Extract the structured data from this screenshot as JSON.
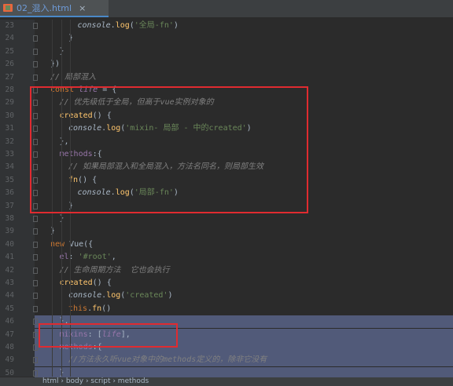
{
  "tab": {
    "title": "02_混入.html",
    "close": "×"
  },
  "lines": [
    {
      "n": "23",
      "indent": 3,
      "tokens": [
        [
          "ital plain",
          "console"
        ],
        [
          "plain",
          "."
        ],
        [
          "fn",
          "log"
        ],
        [
          "plain",
          "("
        ],
        [
          "str",
          "'全局-fn'"
        ],
        [
          "plain",
          ")"
        ]
      ]
    },
    {
      "n": "24",
      "indent": 2,
      "tokens": [
        [
          "plain",
          "}"
        ]
      ]
    },
    {
      "n": "25",
      "indent": 1,
      "tokens": [
        [
          "plain",
          "}"
        ]
      ]
    },
    {
      "n": "26",
      "indent": 0,
      "tokens": [
        [
          "plain",
          "})"
        ]
      ]
    },
    {
      "n": "27",
      "indent": 0,
      "tokens": [
        [
          "cmt",
          "// 局部混入"
        ]
      ]
    },
    {
      "n": "28",
      "indent": 0,
      "tokens": [
        [
          "kw",
          "const "
        ],
        [
          "prop ital",
          "life"
        ],
        [
          "plain",
          " = {"
        ]
      ]
    },
    {
      "n": "29",
      "indent": 1,
      "tokens": [
        [
          "cmt",
          "// 优先级低于全局，但高于vue实例对象的"
        ]
      ]
    },
    {
      "n": "30",
      "indent": 1,
      "tokens": [
        [
          "fn",
          "created"
        ],
        [
          "plain",
          "() {"
        ]
      ]
    },
    {
      "n": "31",
      "indent": 2,
      "tokens": [
        [
          "ital plain",
          "console"
        ],
        [
          "plain",
          "."
        ],
        [
          "fn",
          "log"
        ],
        [
          "plain",
          "("
        ],
        [
          "str",
          "'mixin- 局部 - 中的created'"
        ],
        [
          "plain",
          ")"
        ]
      ]
    },
    {
      "n": "32",
      "indent": 1,
      "tokens": [
        [
          "plain",
          "},"
        ]
      ]
    },
    {
      "n": "33",
      "indent": 1,
      "tokens": [
        [
          "prop",
          "methods"
        ],
        [
          "plain",
          ":{"
        ]
      ]
    },
    {
      "n": "34",
      "indent": 2,
      "tokens": [
        [
          "cmt",
          "// 如果局部混入和全局混入，方法名同名，则局部生效"
        ]
      ]
    },
    {
      "n": "35",
      "indent": 2,
      "tokens": [
        [
          "fn",
          "fn"
        ],
        [
          "plain",
          "() {"
        ]
      ]
    },
    {
      "n": "36",
      "indent": 3,
      "tokens": [
        [
          "ital plain",
          "console"
        ],
        [
          "plain",
          "."
        ],
        [
          "fn",
          "log"
        ],
        [
          "plain",
          "("
        ],
        [
          "str",
          "'局部-fn'"
        ],
        [
          "plain",
          ")"
        ]
      ]
    },
    {
      "n": "37",
      "indent": 2,
      "tokens": [
        [
          "plain",
          "}"
        ]
      ]
    },
    {
      "n": "38",
      "indent": 1,
      "tokens": [
        [
          "plain",
          "}"
        ]
      ]
    },
    {
      "n": "39",
      "indent": 0,
      "tokens": [
        [
          "plain",
          "}"
        ]
      ]
    },
    {
      "n": "40",
      "indent": 0,
      "tokens": [
        [
          "kw",
          "new "
        ],
        [
          "plain",
          "Vue({"
        ]
      ]
    },
    {
      "n": "41",
      "indent": 1,
      "tokens": [
        [
          "prop",
          "el"
        ],
        [
          "plain",
          ": "
        ],
        [
          "str",
          "'#root'"
        ],
        [
          "plain",
          ","
        ]
      ]
    },
    {
      "n": "42",
      "indent": 1,
      "tokens": [
        [
          "cmt",
          "// 生命周期方法  它也会执行"
        ]
      ]
    },
    {
      "n": "43",
      "indent": 1,
      "tokens": [
        [
          "fn",
          "created"
        ],
        [
          "plain",
          "() {"
        ]
      ]
    },
    {
      "n": "44",
      "indent": 2,
      "tokens": [
        [
          "ital plain",
          "console"
        ],
        [
          "plain",
          "."
        ],
        [
          "fn",
          "log"
        ],
        [
          "plain",
          "("
        ],
        [
          "str",
          "'created'"
        ],
        [
          "plain",
          ")"
        ]
      ]
    },
    {
      "n": "45",
      "indent": 2,
      "tokens": [
        [
          "kw",
          "this"
        ],
        [
          "plain",
          "."
        ],
        [
          "fn",
          "fn"
        ],
        [
          "plain",
          "()"
        ]
      ]
    },
    {
      "n": "46",
      "indent": 1,
      "tokens": [
        [
          "plain",
          "},"
        ]
      ],
      "sel": true
    },
    {
      "n": "47",
      "indent": 1,
      "tokens": [
        [
          "prop",
          "mixins"
        ],
        [
          "plain",
          ": ["
        ],
        [
          "prop ital",
          "life"
        ],
        [
          "plain",
          "],"
        ]
      ],
      "sel": true
    },
    {
      "n": "48",
      "indent": 1,
      "tokens": [
        [
          "prop",
          "methods"
        ],
        [
          "plain",
          ":{"
        ]
      ],
      "sel": true
    },
    {
      "n": "49",
      "indent": 2,
      "tokens": [
        [
          "cmt",
          "//方法永久听vue对象中的methods定义的，除非它没有"
        ]
      ],
      "sel": true
    },
    {
      "n": "50",
      "indent": 1,
      "tokens": [
        [
          "plain",
          "}"
        ]
      ],
      "sel": true
    }
  ],
  "statusbar": {
    "breadcrumb": "html  ›  body  ›  script  ›  methods"
  }
}
